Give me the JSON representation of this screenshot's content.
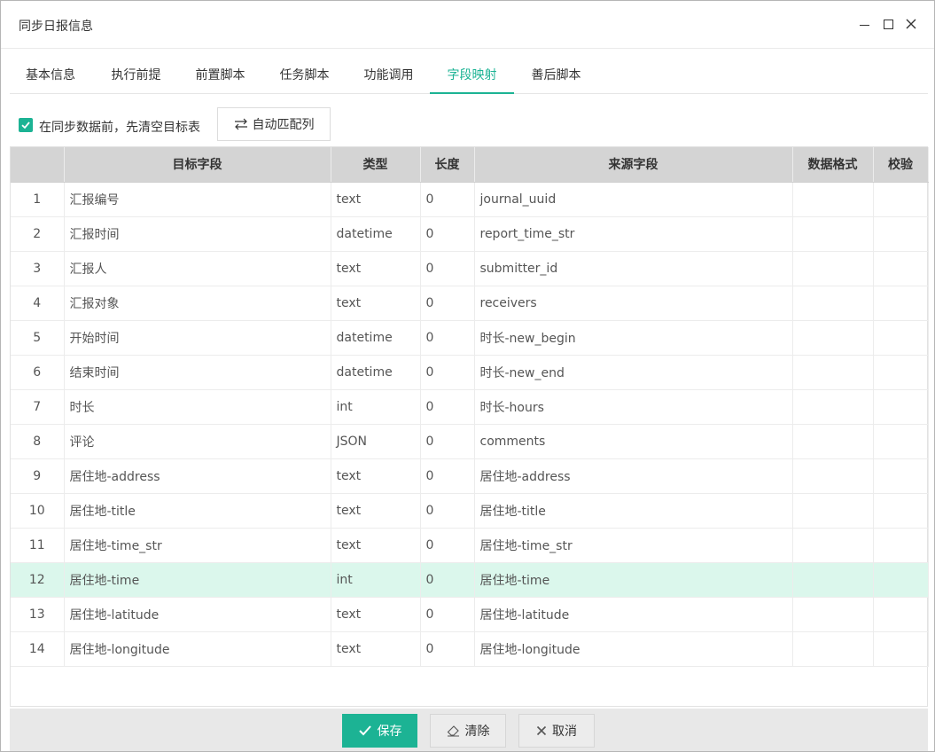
{
  "window": {
    "title": "同步日报信息"
  },
  "tabs": [
    {
      "label": "基本信息"
    },
    {
      "label": "执行前提"
    },
    {
      "label": "前置脚本"
    },
    {
      "label": "任务脚本"
    },
    {
      "label": "功能调用"
    },
    {
      "label": "字段映射",
      "active": true
    },
    {
      "label": "善后脚本"
    }
  ],
  "toolbar": {
    "clear_checkbox_label": "在同步数据前，先清空目标表",
    "clear_checked": true,
    "auto_match_label": "自动匹配列"
  },
  "table": {
    "columns": [
      "",
      "目标字段",
      "类型",
      "长度",
      "来源字段",
      "数据格式",
      "校验"
    ],
    "rows": [
      {
        "index": "1",
        "target": "汇报编号",
        "type": "text",
        "length": "0",
        "source": "journal_uuid",
        "format": "",
        "check": ""
      },
      {
        "index": "2",
        "target": "汇报时间",
        "type": "datetime",
        "length": "0",
        "source": "report_time_str",
        "format": "",
        "check": ""
      },
      {
        "index": "3",
        "target": "汇报人",
        "type": "text",
        "length": "0",
        "source": "submitter_id",
        "format": "",
        "check": ""
      },
      {
        "index": "4",
        "target": "汇报对象",
        "type": "text",
        "length": "0",
        "source": "receivers",
        "format": "",
        "check": ""
      },
      {
        "index": "5",
        "target": "开始时间",
        "type": "datetime",
        "length": "0",
        "source": "时长-new_begin",
        "format": "",
        "check": ""
      },
      {
        "index": "6",
        "target": "结束时间",
        "type": "datetime",
        "length": "0",
        "source": "时长-new_end",
        "format": "",
        "check": ""
      },
      {
        "index": "7",
        "target": "时长",
        "type": "int",
        "length": "0",
        "source": "时长-hours",
        "format": "",
        "check": ""
      },
      {
        "index": "8",
        "target": "评论",
        "type": "JSON",
        "length": "0",
        "source": "comments",
        "format": "",
        "check": ""
      },
      {
        "index": "9",
        "target": "居住地-address",
        "type": "text",
        "length": "0",
        "source": "居住地-address",
        "format": "",
        "check": ""
      },
      {
        "index": "10",
        "target": "居住地-title",
        "type": "text",
        "length": "0",
        "source": "居住地-title",
        "format": "",
        "check": ""
      },
      {
        "index": "11",
        "target": "居住地-time_str",
        "type": "text",
        "length": "0",
        "source": "居住地-time_str",
        "format": "",
        "check": ""
      },
      {
        "index": "12",
        "target": "居住地-time",
        "type": "int",
        "length": "0",
        "source": "居住地-time",
        "format": "",
        "check": "",
        "selected": true
      },
      {
        "index": "13",
        "target": "居住地-latitude",
        "type": "text",
        "length": "0",
        "source": "居住地-latitude",
        "format": "",
        "check": ""
      },
      {
        "index": "14",
        "target": "居住地-longitude",
        "type": "text",
        "length": "0",
        "source": "居住地-longitude",
        "format": "",
        "check": ""
      }
    ]
  },
  "footer": {
    "save_label": "保存",
    "clear_label": "清除",
    "cancel_label": "取消"
  },
  "colors": {
    "accent": "#1cb394",
    "selected_row": "#dbf7ec",
    "header_bg": "#d4d4d4"
  },
  "icons": {
    "minimize": "minimize-icon",
    "maximize": "maximize-icon",
    "close": "close-icon",
    "check": "check-icon",
    "swap": "swap-arrows-icon",
    "save": "checkmark-icon",
    "eraser": "eraser-icon",
    "cancel": "x-icon"
  }
}
